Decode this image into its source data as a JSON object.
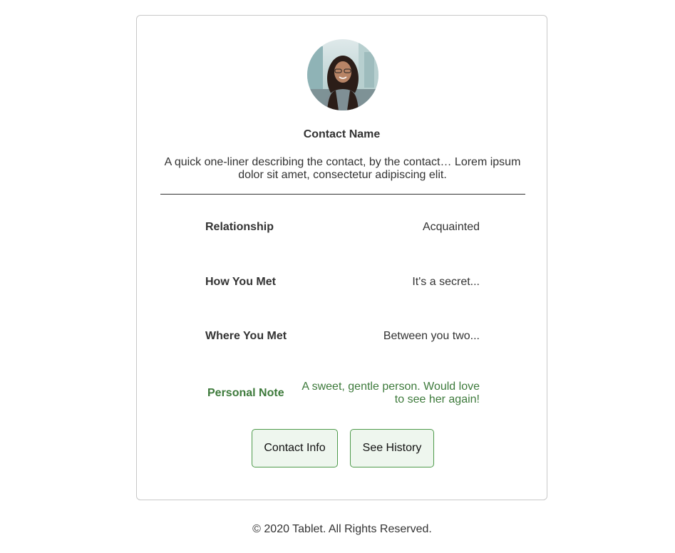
{
  "profile": {
    "avatar_alt": "contact photo",
    "name": "Contact Name",
    "bio": "A quick one-liner describing the contact, by the contact… Lorem ipsum dolor sit amet, consectetur adipiscing elit."
  },
  "details": [
    {
      "label": "Relationship",
      "value": "Acquainted"
    },
    {
      "label": "How You Met",
      "value": "It's a secret..."
    },
    {
      "label": "Where You Met",
      "value": "Between you two..."
    },
    {
      "label": "Personal Note",
      "value": "A sweet, gentle person. Would love to see her again!"
    }
  ],
  "actions": {
    "contact_info": "Contact Info",
    "see_history": "See History"
  },
  "footer": {
    "text": "© 2020 Tablet. All Rights Reserved."
  },
  "colors": {
    "accent": "#3d7a3b",
    "button_border": "#4e9a4b",
    "button_bg": "#eef6ee",
    "text": "#333333"
  }
}
